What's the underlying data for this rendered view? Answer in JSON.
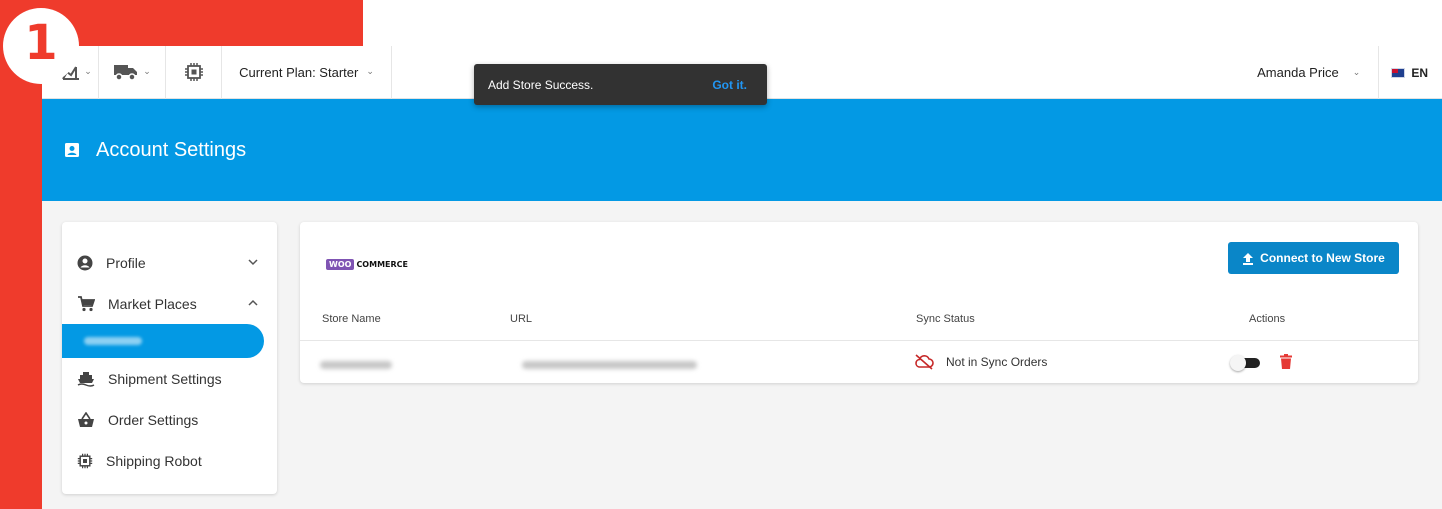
{
  "step_marker": {
    "number": "1",
    "color": "#ef3b2c"
  },
  "topbar": {
    "icons": [
      "chart-icon",
      "truck-icon",
      "chip-icon"
    ],
    "plan_label": "Current Plan: Starter",
    "user_name": "Amanda Price",
    "language": "EN"
  },
  "toast": {
    "message": "Add Store Success.",
    "action": "Got it."
  },
  "header": {
    "title": "Account Settings",
    "color": "#0399e4"
  },
  "sidebar": {
    "items": [
      {
        "label": "Profile",
        "icon": "account-circle-icon",
        "expanded": false
      },
      {
        "label": "Market Places",
        "icon": "cart-icon",
        "expanded": true
      },
      {
        "label": "Shipment Settings",
        "icon": "ship-icon"
      },
      {
        "label": "Order Settings",
        "icon": "basket-icon"
      },
      {
        "label": "Shipping Robot",
        "icon": "chip-icon"
      }
    ],
    "selected_sub_item": "(redacted)"
  },
  "store_card": {
    "platform_logo": {
      "badge": "WOO",
      "text": "COMMERCE"
    },
    "connect_button": "Connect to New Store",
    "columns": [
      "Store Name",
      "URL",
      "Sync Status",
      "Actions"
    ],
    "rows": [
      {
        "store_name": "(redacted)",
        "url": "(redacted)",
        "sync_status": "Not in Sync Orders",
        "sync_enabled": false
      }
    ],
    "colors": {
      "button": "#0a86c8",
      "danger": "#e53935",
      "sync_off": "#c62828"
    }
  }
}
